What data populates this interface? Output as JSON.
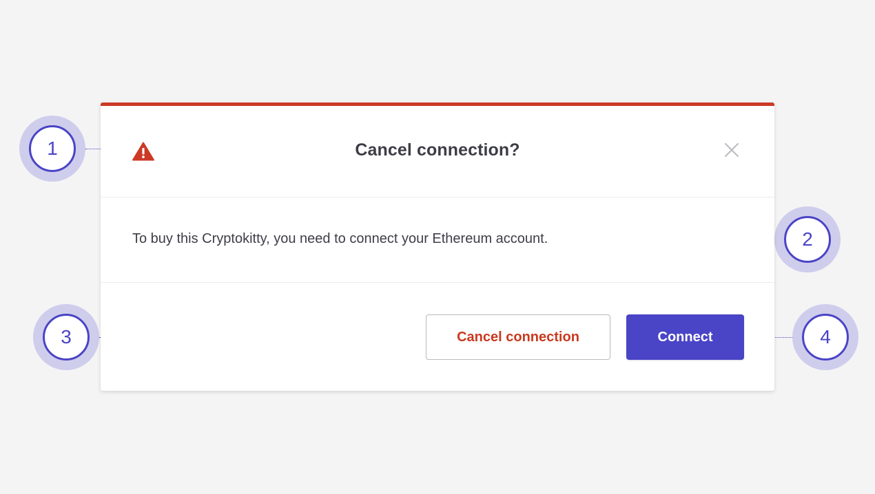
{
  "dialog": {
    "title": "Cancel connection?",
    "message": "To buy this Cryptokitty, you need to connect your Ethereum account.",
    "icon": "warning-triangle-icon",
    "close_icon": "close-icon",
    "cancel_label": "Cancel connection",
    "connect_label": "Connect"
  },
  "callouts": [
    {
      "label": "1"
    },
    {
      "label": "2"
    },
    {
      "label": "3"
    },
    {
      "label": "4"
    }
  ],
  "colors": {
    "accent": "#4a44c6",
    "danger": "#cc3a26",
    "background": "#f4f4f5",
    "callout_halo": "#cfcdec"
  }
}
